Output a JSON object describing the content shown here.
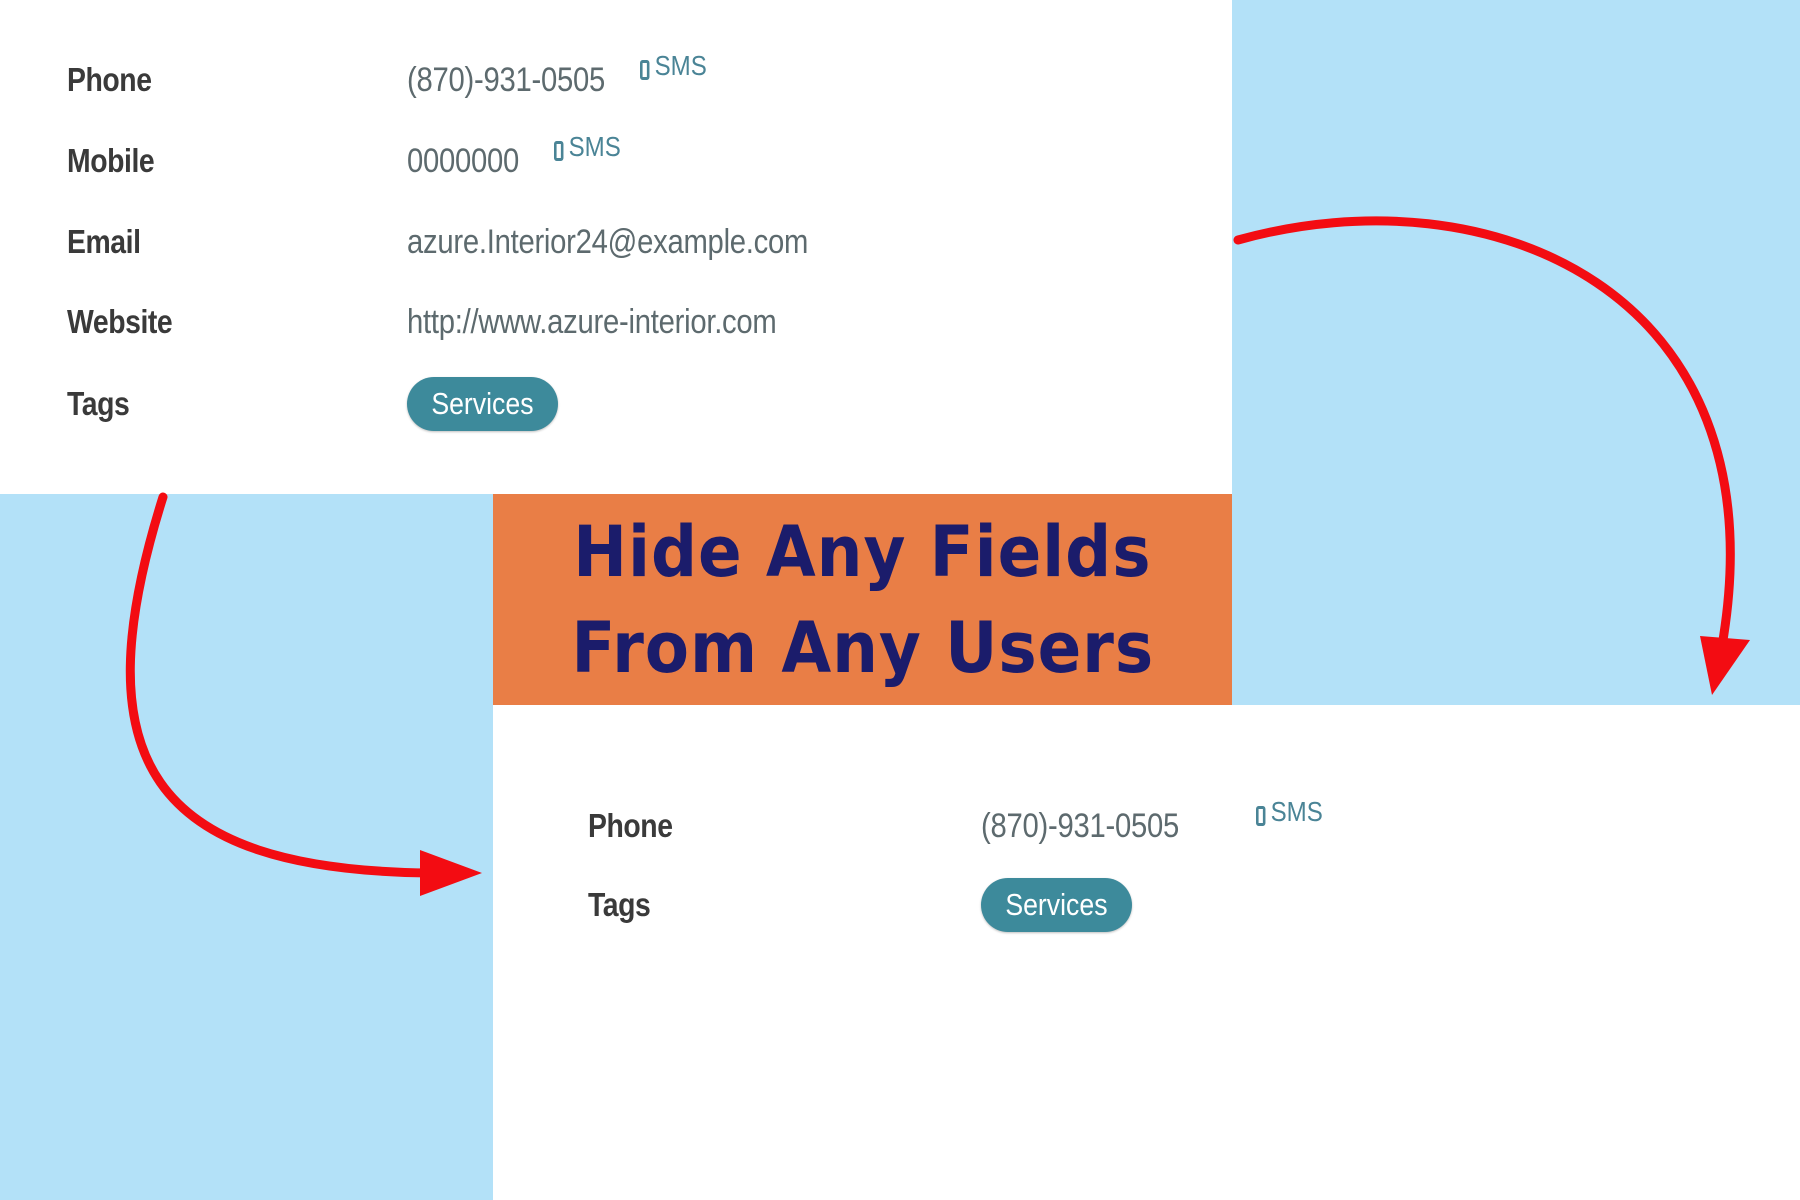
{
  "before": {
    "fields": [
      {
        "label": "Phone",
        "value": "(870)-931-0505",
        "sms": "SMS"
      },
      {
        "label": "Mobile",
        "value": "0000000",
        "sms": "SMS"
      },
      {
        "label": "Email",
        "value": "azure.Interior24@example.com"
      },
      {
        "label": "Website",
        "value": "http://www.azure-interior.com"
      },
      {
        "label": "Tags",
        "tag": "Services"
      }
    ]
  },
  "banner": {
    "line1": "Hide Any Fields",
    "line2": "From Any Users"
  },
  "after": {
    "fields": [
      {
        "label": "Phone",
        "value": "(870)-931-0505",
        "sms": "SMS"
      },
      {
        "label": "Tags",
        "tag": "Services"
      }
    ]
  },
  "colors": {
    "background": "#b3e1f8",
    "banner": "#e97e46",
    "banner_text": "#1b1c6b",
    "arrow": "#f30c12",
    "tag": "#3d8a9b"
  }
}
